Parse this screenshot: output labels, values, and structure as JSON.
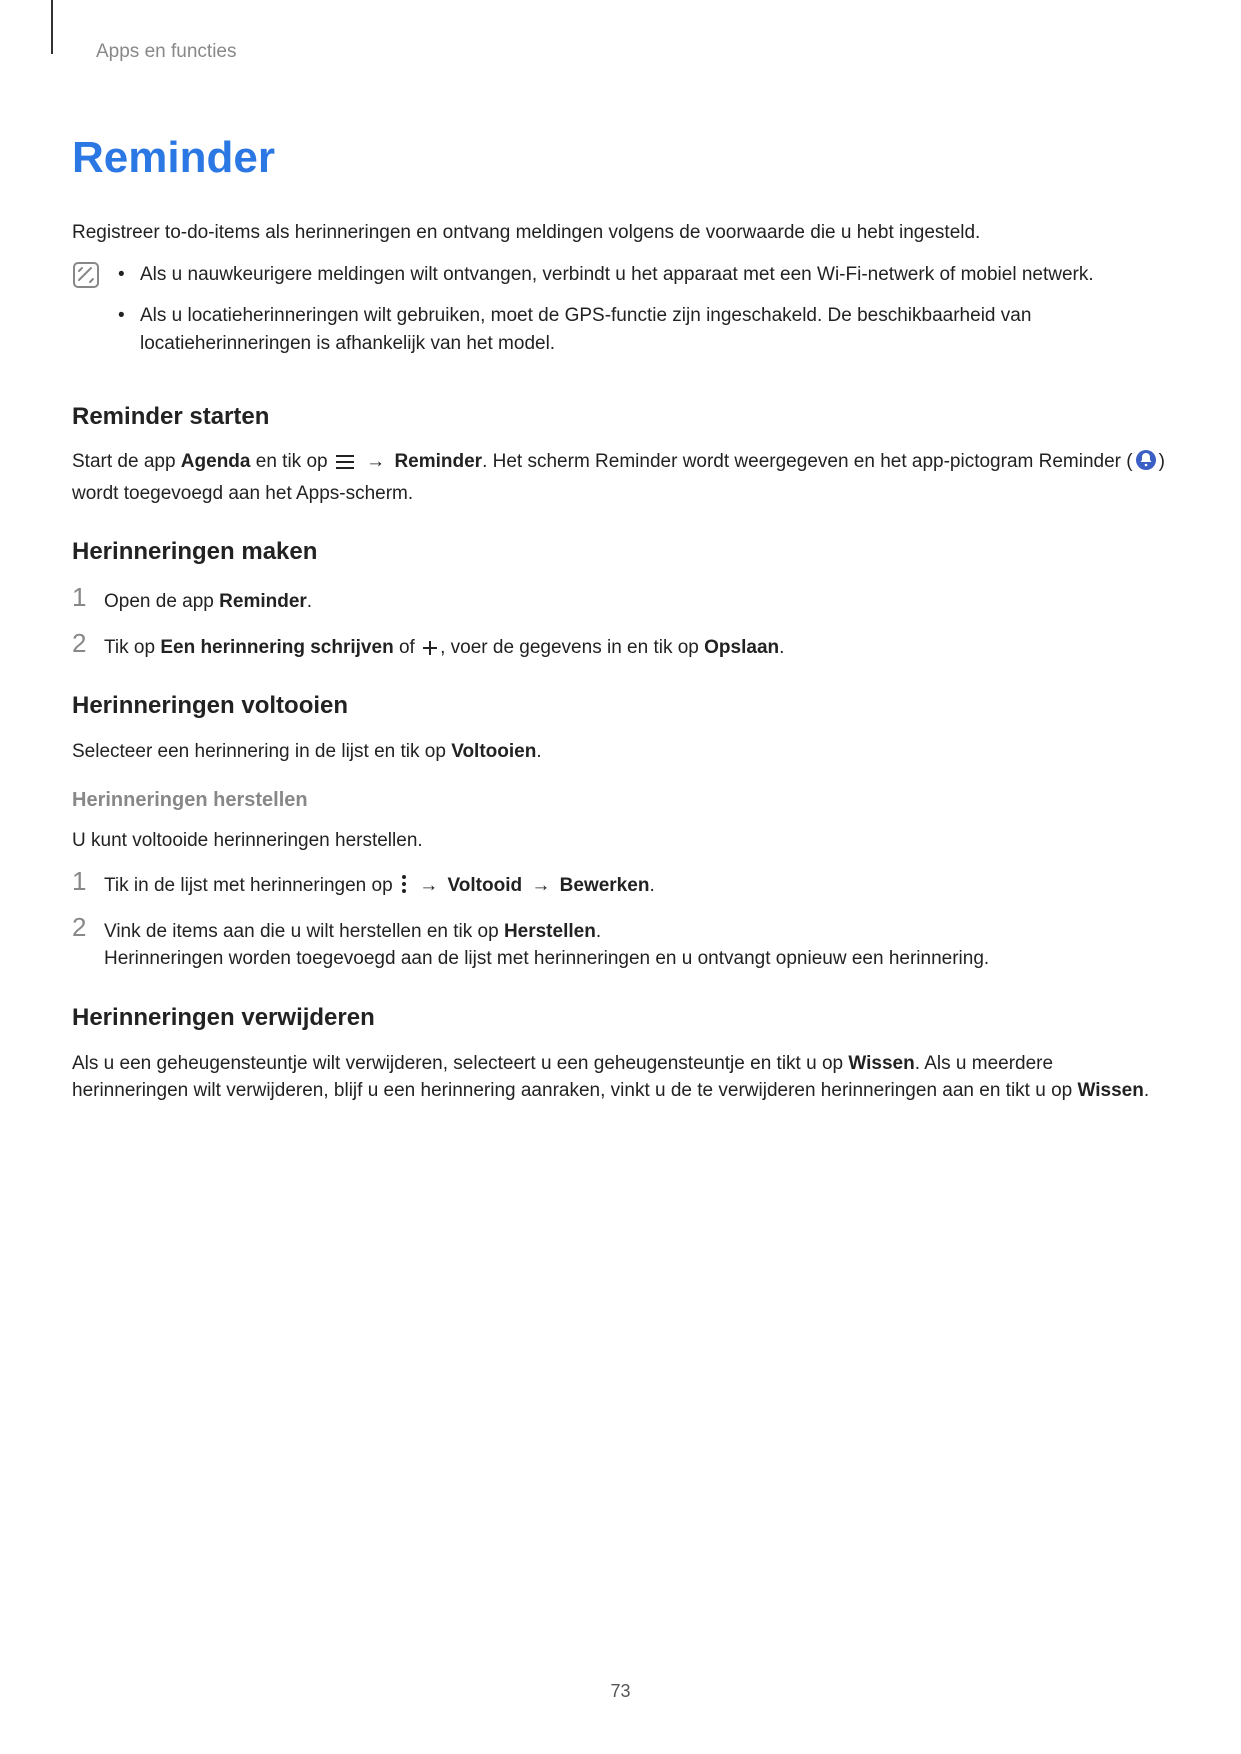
{
  "breadcrumb": "Apps en functies",
  "title": "Reminder",
  "intro": "Registreer to-do-items als herinneringen en ontvang meldingen volgens de voorwaarde die u hebt ingesteld.",
  "notes": {
    "item1": "Als u nauwkeurigere meldingen wilt ontvangen, verbindt u het apparaat met een Wi-Fi-netwerk of mobiel netwerk.",
    "item2": "Als u locatieherinneringen wilt gebruiken, moet de GPS-functie zijn ingeschakeld. De beschikbaarheid van locatieherinneringen is afhankelijk van het model."
  },
  "start": {
    "heading": "Reminder starten",
    "p_a": "Start de app ",
    "agenda": "Agenda",
    "p_b": " en tik op ",
    "reminder": "Reminder",
    "p_c": ". Het scherm Reminder wordt weergegeven en het app-pictogram Reminder (",
    "p_d": ") wordt toegevoegd aan het Apps-scherm."
  },
  "maken": {
    "heading": "Herinneringen maken",
    "step1_a": "Open de app ",
    "step1_b": "Reminder",
    "step1_c": ".",
    "step2_a": "Tik op ",
    "step2_b": "Een herinnering schrijven",
    "step2_c": " of ",
    "step2_d": ", voer de gegevens in en tik op ",
    "step2_e": "Opslaan",
    "step2_f": "."
  },
  "voltooien": {
    "heading": "Herinneringen voltooien",
    "p_a": "Selecteer een herinnering in de lijst en tik op ",
    "p_b": "Voltooien",
    "p_c": "."
  },
  "herstellen": {
    "heading": "Herinneringen herstellen",
    "intro": "U kunt voltooide herinneringen herstellen.",
    "step1_a": "Tik in de lijst met herinneringen op ",
    "voltooid": "Voltooid",
    "bewerken": "Bewerken",
    "step1_dot": ".",
    "step2_a": "Vink de items aan die u wilt herstellen en tik op ",
    "herstellen": "Herstellen",
    "step2_b": ".",
    "step2_c": "Herinneringen worden toegevoegd aan de lijst met herinneringen en u ontvangt opnieuw een herinnering."
  },
  "verwijderen": {
    "heading": "Herinneringen verwijderen",
    "p_a": "Als u een geheugensteuntje wilt verwijderen, selecteert u een geheugensteuntje en tikt u op ",
    "wissen": "Wissen",
    "p_b": ". Als u meerdere herinneringen wilt verwijderen, blijf u een herinnering aanraken, vinkt u de te verwijderen herinneringen aan en tikt u op ",
    "p_c": "."
  },
  "arrow": "→",
  "pagenum": "73"
}
